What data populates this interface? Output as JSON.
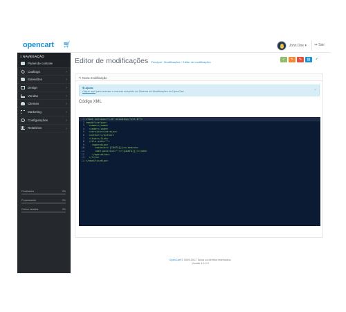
{
  "header": {
    "logo_text": "opencart",
    "logo_mark": "`͡`",
    "user_name": "John Doe ▾",
    "logout_label": "↦ Sair"
  },
  "sidebar": {
    "heading": "≡ NAVEGAÇÃO",
    "items": [
      {
        "label": "Painel de controle",
        "icon": "dashboard-icon"
      },
      {
        "label": "Catálogo",
        "icon": "tag-icon"
      },
      {
        "label": "Extensões",
        "icon": "puzzle-icon"
      },
      {
        "label": "Design",
        "icon": "monitor-icon"
      },
      {
        "label": "Vendas",
        "icon": "cart-icon"
      },
      {
        "label": "Clientes",
        "icon": "user-icon"
      },
      {
        "label": "Marketing",
        "icon": "share-icon"
      },
      {
        "label": "Configurações",
        "icon": "gear-icon"
      },
      {
        "label": "Relatórios",
        "icon": "bar-chart-icon"
      }
    ],
    "stats": [
      {
        "label": "Finalizados",
        "value": "0%",
        "fill": 0.0
      },
      {
        "label": "Processando",
        "value": "0%",
        "fill": 0.0
      },
      {
        "label": "Outros estados",
        "value": "0%",
        "fill": 0.0
      }
    ]
  },
  "page": {
    "title": "Editor de modificações",
    "breadcrumb": [
      "Principal",
      "Modificações",
      "Editor de modificações"
    ],
    "breadcrumb_sep": "›"
  },
  "panel": {
    "heading": "✎ Nova modificação",
    "alert_title": "⚙ Ajuda:",
    "alert_link": "Clique aqui",
    "alert_text": " para acessar o manual completo do Sistema de Modificações do OpenCart.",
    "alert_close": "×",
    "section_title": "Código XML"
  },
  "code_lines": [
    {
      "num": "1",
      "text": "<?xml version=\"1.0\" encoding=\"utf-8\"?>"
    },
    {
      "num": "2",
      "text": "<modification>"
    },
    {
      "num": "3",
      "text": "  <name></name>"
    },
    {
      "num": "4",
      "text": "  <code></code>"
    },
    {
      "num": "5",
      "text": "  <version></version>"
    },
    {
      "num": "6",
      "text": "  <author></author>"
    },
    {
      "num": "7",
      "text": "  <link></link>"
    },
    {
      "num": "8",
      "text": "  <file path=\"\">"
    },
    {
      "num": "9",
      "text": "    <operation>"
    },
    {
      "num": "10",
      "text": "      <search><![CDATA[]]></search>"
    },
    {
      "num": "11",
      "text": "      <add position=\"\"><![CDATA[]]></add>"
    },
    {
      "num": "12",
      "text": "    </operation>"
    },
    {
      "num": "13",
      "text": "  </file>"
    },
    {
      "num": "14",
      "text": "</modification>"
    }
  ],
  "footer": {
    "brand": "OpenCart",
    "copyright": " © 2009-2017 Todos os direitos reservados.",
    "version": "Versão 3.0.2.0"
  },
  "colors": {
    "accent": "#1e91cf",
    "sidebar_bg": "#25282d",
    "editor_bg": "#0b1b33",
    "btn_green": "#8fbb6c",
    "btn_orange": "#f38733",
    "btn_red": "#e3503e",
    "btn_blue": "#1e91cf"
  }
}
